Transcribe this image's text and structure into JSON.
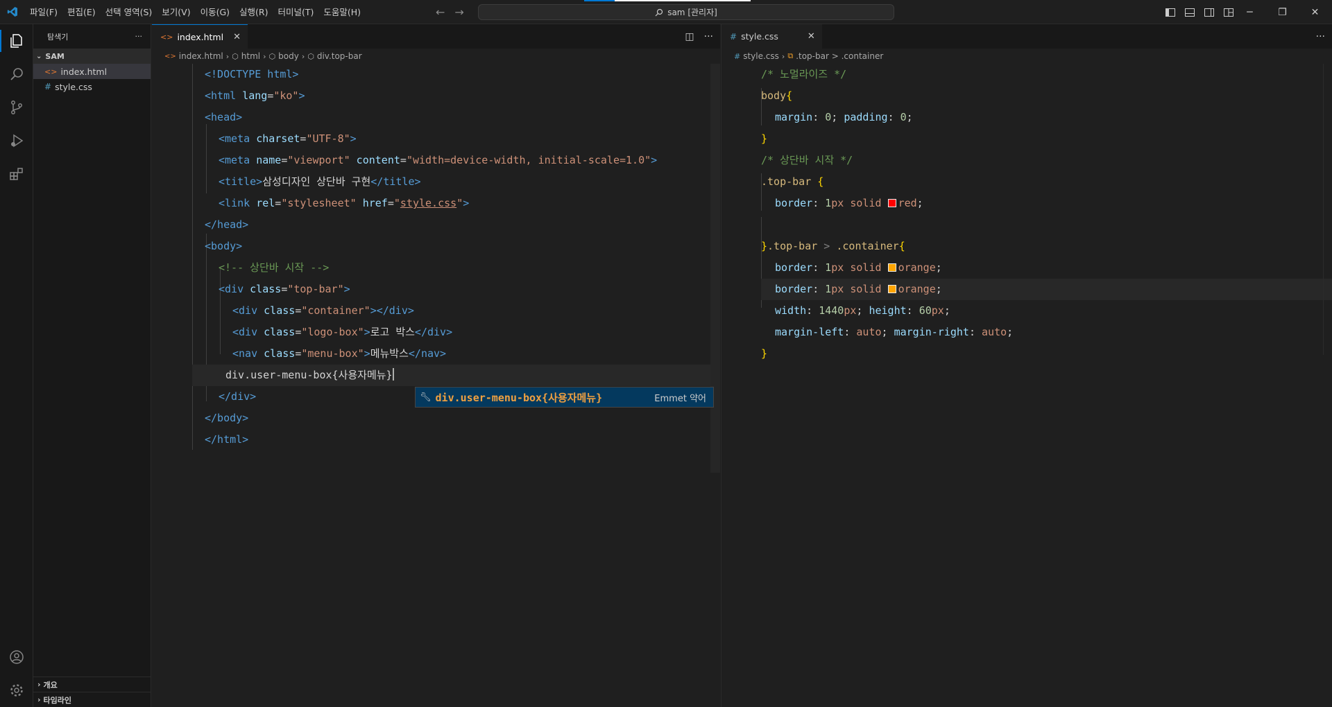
{
  "titlebar": {
    "menu": [
      "파일(F)",
      "편집(E)",
      "선택 영역(S)",
      "보기(V)",
      "이동(G)",
      "실행(R)",
      "터미널(T)",
      "도움말(H)"
    ],
    "search": "sam [관리자]"
  },
  "sidebar": {
    "title": "탐색기",
    "more": "···",
    "folder": "SAM",
    "files": [
      "index.html",
      "style.css"
    ],
    "sections": [
      "개요",
      "타임라인"
    ]
  },
  "editor_left": {
    "tab": "index.html",
    "breadcrumbs": [
      "index.html",
      "html",
      "body",
      "div.top-bar"
    ],
    "lines": {
      "l1": "<!DOCTYPE html>",
      "l2a": "<html ",
      "l2b": "lang",
      "l2c": "=",
      "l2d": "\"ko\"",
      "l2e": ">",
      "l3": "<head>",
      "l4a": "<meta ",
      "l4b": "charset",
      "l4c": "=",
      "l4d": "\"UTF-8\"",
      "l4e": ">",
      "l5a": "<meta ",
      "l5b": "name",
      "l5c": "=",
      "l5d": "\"viewport\"",
      "l5e": " content",
      "l5f": "=",
      "l5g": "\"width=device-width, initial-scale=1.0\"",
      "l5h": ">",
      "l6a": "<title>",
      "l6b": "삼성디자인 상단바 구현",
      "l6c": "</title>",
      "l7a": "<link ",
      "l7b": "rel",
      "l7c": "=",
      "l7d": "\"stylesheet\"",
      "l7e": " href",
      "l7f": "=",
      "l7g": "\"",
      "l7h": "style.css",
      "l7i": "\"",
      "l7j": ">",
      "l8": "</head>",
      "l9": "<body>",
      "l10": "<!-- 상단바 시작 -->",
      "l11a": "<div ",
      "l11b": "class",
      "l11c": "=",
      "l11d": "\"top-bar\"",
      "l11e": ">",
      "l12a": "<div ",
      "l12b": "class",
      "l12c": "=",
      "l12d": "\"container\"",
      "l12e": "></div>",
      "l13a": "<div ",
      "l13b": "class",
      "l13c": "=",
      "l13d": "\"logo-box\"",
      "l13e": ">",
      "l13f": "로고 박스",
      "l13g": "</div>",
      "l14a": "<nav ",
      "l14b": "class",
      "l14c": "=",
      "l14d": "\"menu-box\"",
      "l14e": ">",
      "l14f": "메뉴박스",
      "l14g": "</nav>",
      "l15": "div.user-menu-box{사용자메뉴}",
      "l16": "</div>",
      "l17": "</body>",
      "l18": "</html>"
    },
    "suggest": {
      "label": "div.user-menu-box{사용자메뉴}",
      "detail": "Emmet 약어"
    }
  },
  "editor_right": {
    "tab": "style.css",
    "breadcrumbs": [
      "style.css",
      ".top-bar > .container"
    ],
    "lines": {
      "c1": "/* 노멀라이즈 */",
      "c2a": "body",
      "c2b": "{",
      "c3a": "margin",
      "c3b": ": ",
      "c3c": "0",
      "c3d": "; ",
      "c3e": "padding",
      "c3f": ": ",
      "c3g": "0",
      "c3h": ";",
      "c4": "}",
      "c5": "/* 상단바 시작 */",
      "c6a": ".top-bar",
      "c6b": " {",
      "c7a": "border",
      "c7b": ": ",
      "c7c": "1",
      "c7d": "px",
      "c7e": " solid ",
      "c7f": "red",
      "c7g": ";",
      "c9a": "}",
      "c9b": ".top-bar",
      "c9c": " > ",
      "c9d": ".container",
      "c9e": "{",
      "c10a": "border",
      "c10b": ": ",
      "c10c": "1",
      "c10d": "px",
      "c10e": " solid ",
      "c10f": "orange",
      "c10g": ";",
      "c11a": "border",
      "c11b": ": ",
      "c11c": "1",
      "c11d": "px",
      "c11e": " solid ",
      "c11f": "orange",
      "c11g": ";",
      "c12a": "width",
      "c12b": ": ",
      "c12c": "1440",
      "c12d": "px",
      "c12e": "; ",
      "c12f": "height",
      "c12g": ": ",
      "c12h": "60",
      "c12i": "px",
      "c12j": ";",
      "c13a": "margin-left",
      "c13b": ": ",
      "c13c": "auto",
      "c13d": "; ",
      "c13e": "margin-right",
      "c13f": ": ",
      "c13g": "auto",
      "c13h": ";",
      "c14": "}"
    }
  },
  "colors": {
    "accent": "#0078d4",
    "red_swatch": "#ff0000",
    "orange_swatch": "#ffa500"
  }
}
